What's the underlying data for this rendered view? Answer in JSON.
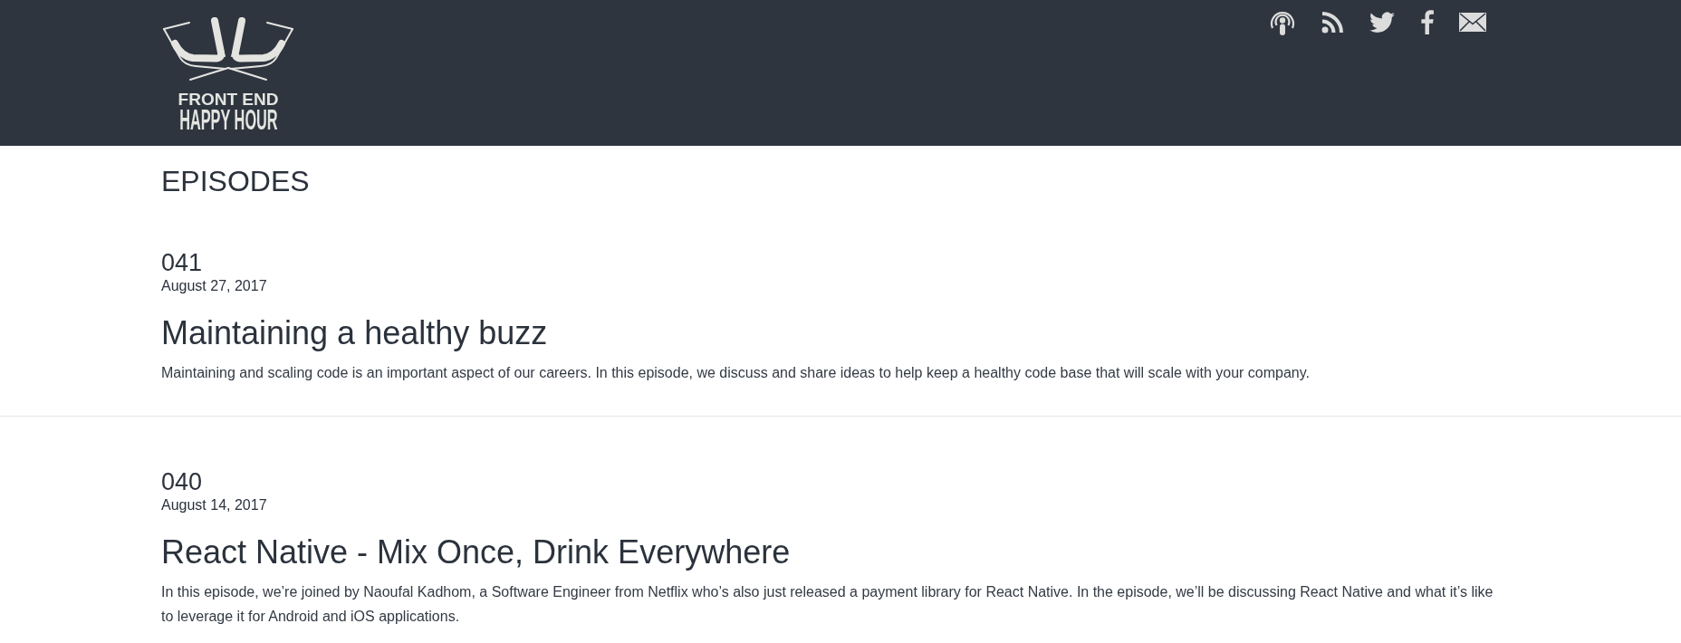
{
  "header": {
    "logo": {
      "lines": [
        "FRONT END",
        "HAPPY HOUR"
      ]
    }
  },
  "page_title": "EPISODES",
  "episodes": [
    {
      "number": "041",
      "date": "August 27, 2017",
      "title": "Maintaining a healthy buzz",
      "description": "Maintaining and scaling code is an important aspect of our careers. In this episode, we discuss and share ideas to help keep a healthy code base that will scale with your company."
    },
    {
      "number": "040",
      "date": "August 14, 2017",
      "title": "React Native - Mix Once, Drink Everywhere",
      "description": "In this episode, we’re joined by Naoufal Kadhom, a Software Engineer from Netflix who’s also just released a payment library for React Native. In the episode, we’ll be discussing React Native and what it’s like to leverage it for Android and iOS applications."
    }
  ]
}
